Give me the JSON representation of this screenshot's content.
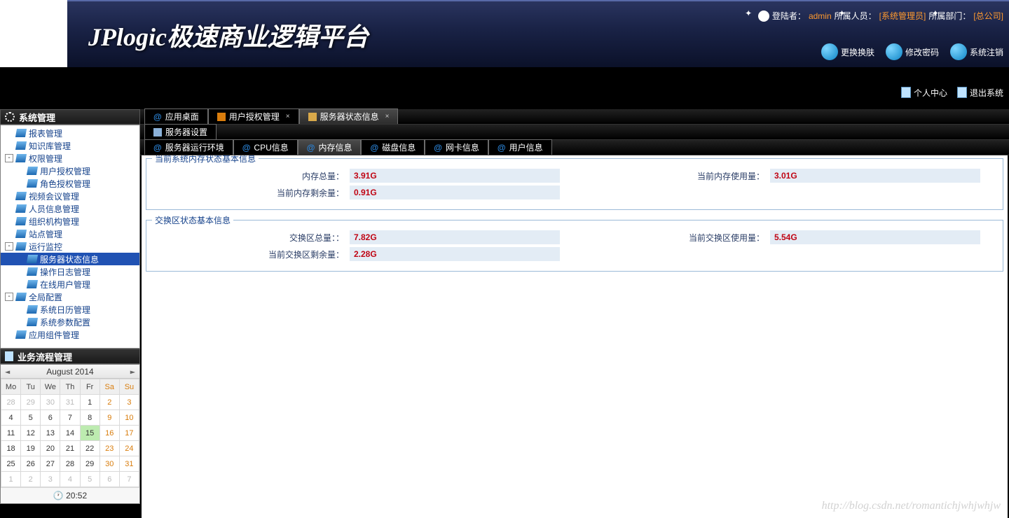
{
  "header": {
    "platform_title": "JPlogic极速商业逻辑平台",
    "login_prefix": "登陆者：",
    "login_user": "admin",
    "member_prefix": " 所属人员：",
    "member_value": "[系统管理员]",
    "dept_prefix": " 所属部门：",
    "dept_value": "[总公司]",
    "actions": {
      "skin": "更换换肤",
      "pwd": "修改密码",
      "logout": "系统注销"
    }
  },
  "top_right": {
    "personal": "个人中心",
    "exit": "退出系统"
  },
  "sidebar": {
    "panel1_title": "系统管理",
    "panel2_title": "业务流程管理",
    "tree": {
      "reports": "报表管理",
      "knowledge": "知识库管理",
      "perm": "权限管理",
      "user_auth": "用户授权管理",
      "role_auth": "角色授权管理",
      "video": "视频会议管理",
      "person_info": "人员信息管理",
      "org": "组织机构管理",
      "site": "站点管理",
      "runtime": "运行监控",
      "server_status": "服务器状态信息",
      "op_log": "操作日志管理",
      "online_user": "在线用户管理",
      "global": "全局配置",
      "sys_cal": "系统日历管理",
      "sys_param": "系统参数配置",
      "app_comp": "应用组件管理"
    }
  },
  "calendar": {
    "title": "August 2014",
    "headers": [
      "Mo",
      "Tu",
      "We",
      "Th",
      "Fr",
      "Sa",
      "Su"
    ],
    "grid": [
      [
        "28",
        "29",
        "30",
        "31",
        "1",
        "2",
        "3"
      ],
      [
        "4",
        "5",
        "6",
        "7",
        "8",
        "9",
        "10"
      ],
      [
        "11",
        "12",
        "13",
        "14",
        "15",
        "16",
        "17"
      ],
      [
        "18",
        "19",
        "20",
        "21",
        "22",
        "23",
        "24"
      ],
      [
        "25",
        "26",
        "27",
        "28",
        "29",
        "30",
        "31"
      ],
      [
        "1",
        "2",
        "3",
        "4",
        "5",
        "6",
        "7"
      ]
    ],
    "today_cell": "15",
    "time": "20:52"
  },
  "tabs": {
    "level1": {
      "desktop": "应用桌面",
      "user_auth": "用户授权管理",
      "server_status": "服务器状态信息"
    },
    "level2": {
      "server_settings": "服务器设置"
    },
    "level3": {
      "env": "服务器运行环境",
      "cpu": "CPU信息",
      "mem": "内存信息",
      "disk": "磁盘信息",
      "nic": "网卡信息",
      "user": "用户信息"
    }
  },
  "memory": {
    "fieldset1_title": "当前系统内存状态基本信息",
    "fieldset2_title": "交换区状态基本信息",
    "total_mem_label": "内存总量：",
    "total_mem_val": "3.91G",
    "used_mem_label": "当前内存使用量：",
    "used_mem_val": "3.01G",
    "free_mem_label": "当前内存剩余量：",
    "free_mem_val": "0.91G",
    "swap_total_label": "交换区总量：：",
    "swap_total_val": "7.82G",
    "swap_used_label": "当前交换区使用量：",
    "swap_used_val": "5.54G",
    "swap_free_label": "当前交换区剩余量：",
    "swap_free_val": "2.28G"
  },
  "watermark": "http://blog.csdn.net/romantichjwhjwhjw"
}
